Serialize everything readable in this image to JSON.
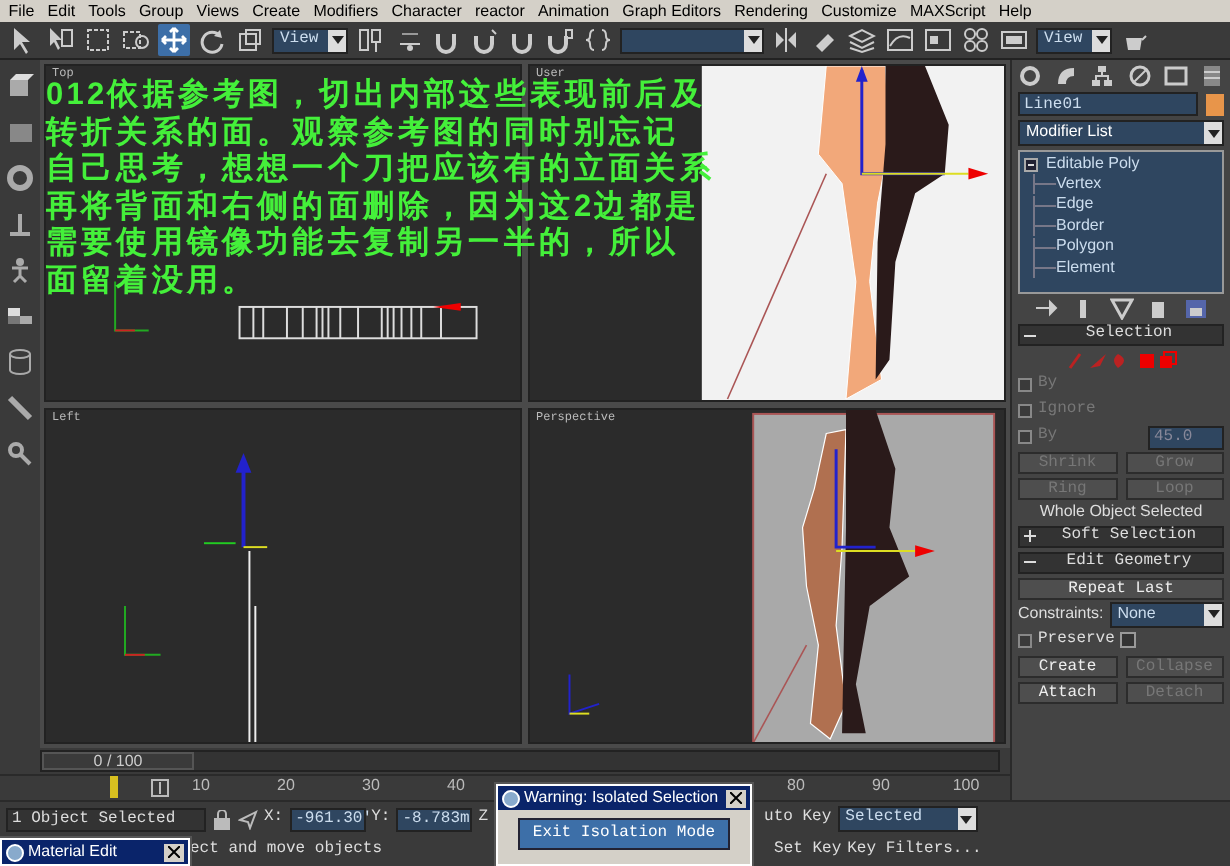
{
  "menu": [
    "File",
    "Edit",
    "Tools",
    "Group",
    "Views",
    "Create",
    "Modifiers",
    "Character",
    "reactor",
    "Animation",
    "Graph Editors",
    "Rendering",
    "Customize",
    "MAXScript",
    "Help"
  ],
  "toolbar": [
    {
      "kind": "tool",
      "selected": false
    },
    {
      "kind": "tool",
      "selected": false
    },
    {
      "kind": "tool",
      "selected": false
    },
    {
      "kind": "tool",
      "selected": false
    },
    {
      "kind": "tool",
      "selected": true
    },
    {
      "kind": "tool",
      "selected": false
    },
    {
      "kind": "tool",
      "selected": false
    },
    {
      "kind": "dropdown",
      "value": "View"
    },
    {
      "kind": "tool",
      "selected": false
    },
    {
      "kind": "tool",
      "selected": false
    },
    {
      "kind": "tool",
      "selected": false
    },
    {
      "kind": "tool",
      "selected": false
    },
    {
      "kind": "tool",
      "selected": false
    },
    {
      "kind": "tool",
      "selected": false
    },
    {
      "kind": "tool",
      "selected": false
    },
    {
      "kind": "combo"
    },
    {
      "kind": "tool",
      "selected": false
    },
    {
      "kind": "tool",
      "selected": false
    },
    {
      "kind": "tool",
      "selected": false
    },
    {
      "kind": "tool",
      "selected": false
    },
    {
      "kind": "tool",
      "selected": false
    },
    {
      "kind": "tool",
      "selected": false
    },
    {
      "kind": "tool",
      "selected": false
    },
    {
      "kind": "dropdown",
      "value": "View"
    },
    {
      "kind": "tool",
      "selected": false
    }
  ],
  "viewports": [
    {
      "label": "Top",
      "kind": "top"
    },
    {
      "label": "User",
      "kind": "user"
    },
    {
      "label": "Left",
      "kind": "left"
    },
    {
      "label": "Perspective",
      "kind": "perspective"
    }
  ],
  "annotation": {
    "lines": [
      "012依据参考图，切出内部这些表现前后及",
      "转折关系的面。观察参考图的同时别忘记",
      "自己思考，想想一个刀把应该有的立面关系",
      "再将背面和右侧的面删除，因为这2边都是",
      "需要使用镜像功能去复制另一半的，所以",
      "面留着没用。"
    ]
  },
  "command_panel": {
    "object": {
      "name": "Line01",
      "color": "#e8954a"
    },
    "modifier_list": "Modifier List",
    "stack": [
      {
        "label": "Editable Poly",
        "expanded": true,
        "children": [
          {
            "label": "Vertex"
          },
          {
            "label": "Edge"
          },
          {
            "label": "Border"
          },
          {
            "label": "Polygon"
          },
          {
            "label": "Element"
          }
        ]
      }
    ],
    "selection": {
      "title": "Selection",
      "expanded": true,
      "options": [
        {
          "label": "By",
          "checked": false,
          "disabled": true
        },
        {
          "label": "Ignore",
          "checked": false,
          "disabled": true
        },
        {
          "label": "By",
          "checked": false,
          "disabled": true,
          "value": "45.0"
        }
      ],
      "buttons": [
        {
          "label": "Shrink",
          "disabled": true
        },
        {
          "label": "Grow",
          "disabled": true
        },
        {
          "label": "Ring",
          "disabled": true
        },
        {
          "label": "Loop",
          "disabled": true
        }
      ],
      "status": "Whole Object Selected"
    },
    "soft_selection": {
      "title": "Soft Selection",
      "expanded": false
    },
    "edit_geometry": {
      "title": "Edit Geometry",
      "expanded": true,
      "repeat_last": "Repeat Last",
      "constraints_label": "Constraints:",
      "constraints_value": "None",
      "preserve": {
        "label": "Preserve",
        "checked": false
      },
      "buttons": [
        {
          "label": "Create",
          "disabled": false
        },
        {
          "label": "Collapse",
          "disabled": true
        },
        {
          "label": "Attach",
          "disabled": false
        },
        {
          "label": "Detach",
          "disabled": true
        }
      ]
    }
  },
  "time_slider": {
    "label": "0 / 100",
    "level": 0
  },
  "ruler": {
    "ticks": [
      "10",
      "20",
      "30",
      "40",
      "80",
      "90",
      "100"
    ]
  },
  "status_bar": {
    "selection": "1 Object Selected",
    "x_label": "X:",
    "x": "-961.30'",
    "y_label": "Y:",
    "y": "-8.783m",
    "z_label": "Z",
    "auto_key": "uto Key",
    "key_mode": "Selected",
    "set_key": "Set Key",
    "key_filters": "Key Filters...",
    "prompt": "ect and move objects"
  },
  "isolation_dialog": {
    "title": "Warning: Isolated Selection",
    "button": "Exit Isolation Mode"
  },
  "material_editor": {
    "title": "Material Edit"
  }
}
